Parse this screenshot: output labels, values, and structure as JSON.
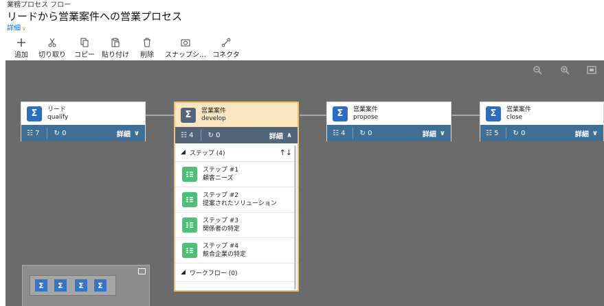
{
  "header": {
    "small": "業務プロセス フロー",
    "title": "リードから営業案件への営業プロセス",
    "detail": "詳細"
  },
  "toolbar": {
    "add": "追加",
    "cut": "切り取り",
    "copy": "コピー",
    "paste": "貼り付け",
    "delete": "削除",
    "snapshot": "スナップシ…",
    "connector": "コネクタ"
  },
  "stages": [
    {
      "entity": "リード",
      "name": "qualify",
      "steps": "7",
      "workflows": "0",
      "detail": "詳細"
    },
    {
      "entity": "営業案件",
      "name": "develop",
      "steps": "4",
      "workflows": "0",
      "detail": "詳細"
    },
    {
      "entity": "営業案件",
      "name": "propose",
      "steps": "4",
      "workflows": "0",
      "detail": "詳細"
    },
    {
      "entity": "営業案件",
      "name": "close",
      "steps": "5",
      "workflows": "0",
      "detail": "詳細"
    }
  ],
  "expanded": {
    "steps_header": "ステップ (4)",
    "steps": [
      {
        "title": "ステップ #1",
        "field": "顧客ニーズ"
      },
      {
        "title": "ステップ #2",
        "field": "提案されたソリューション"
      },
      {
        "title": "ステップ #3",
        "field": "関係者の特定"
      },
      {
        "title": "ステップ #4",
        "field": "競合企業の特定"
      }
    ],
    "workflow_header": "ワークフロー (0)"
  },
  "colors": {
    "canvas": "#6b6b6b",
    "stage_icon": "#2b6cc4",
    "stage_bar": "#3e6f97",
    "selected_header": "#fae7c1",
    "selected_border": "#f0c270",
    "step_icon": "#4bc076",
    "link": "#0070d2"
  },
  "icons": {
    "stage": "sigma-icon",
    "steps": "steps-list-icon",
    "workflow": "workflow-cycle-icon",
    "step": "step-field-icon"
  }
}
